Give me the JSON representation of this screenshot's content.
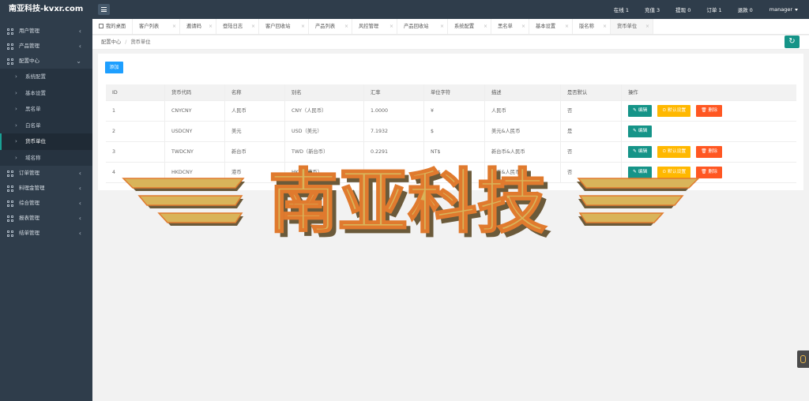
{
  "header": {
    "logo": "南亚科技-kvxr.com",
    "stats": [
      "在线 1",
      "充值 3",
      "提现 0",
      "订单 1",
      "退款 0"
    ],
    "user": "manager"
  },
  "sidebar": {
    "top_items": [
      {
        "label": "用户管理",
        "chevron": "‹"
      },
      {
        "label": "产品管理",
        "chevron": "‹"
      },
      {
        "label": "配置中心",
        "chevron": "⌄"
      }
    ],
    "sub_items": [
      {
        "label": "系统配置"
      },
      {
        "label": "基本设置"
      },
      {
        "label": "黑名单"
      },
      {
        "label": "白名单"
      },
      {
        "label": "货币单位"
      },
      {
        "label": "域名称"
      }
    ],
    "bottom_items": [
      {
        "label": "订单管理",
        "chevron": "‹"
      },
      {
        "label": "料理金管理",
        "chevron": "‹"
      },
      {
        "label": "综合管理",
        "chevron": "‹"
      },
      {
        "label": "报表管理",
        "chevron": "‹"
      },
      {
        "label": "结单管理",
        "chevron": "‹"
      }
    ]
  },
  "tabs": [
    {
      "label": "我的桌面",
      "close": ""
    },
    {
      "label": "客户列表",
      "close": "×"
    },
    {
      "label": "邀请码",
      "close": "×"
    },
    {
      "label": "登陆日志",
      "close": "×"
    },
    {
      "label": "客户回收站",
      "close": "×"
    },
    {
      "label": "产品列表",
      "close": "×"
    },
    {
      "label": "风控管理",
      "close": "×"
    },
    {
      "label": "产品回收站",
      "close": "×"
    },
    {
      "label": "系统配置",
      "close": "×"
    },
    {
      "label": "黑名单",
      "close": "×"
    },
    {
      "label": "基本设置",
      "close": "×"
    },
    {
      "label": "版名称",
      "close": "×"
    },
    {
      "label": "货币单位",
      "close": "×"
    }
  ],
  "breadcrumb": {
    "parent": "配置中心",
    "separator": "/",
    "current": "货币单位"
  },
  "refresh_icon": "↻",
  "add_button": "添加",
  "table": {
    "headers": [
      "ID",
      "货币代码",
      "名称",
      "别名",
      "汇率",
      "单位字符",
      "描述",
      "是否默认",
      "操作"
    ],
    "rows": [
      {
        "cells": [
          "1",
          "CNYCNY",
          "人民币",
          "CNY（人民币）",
          "1.0000",
          "¥",
          "人民币",
          "否"
        ],
        "buttons": [
          "编辑",
          "默认设置",
          "删除"
        ]
      },
      {
        "cells": [
          "2",
          "USDCNY",
          "美元",
          "USD（美元）",
          "7.1932",
          "$",
          "美元&人民币",
          "是"
        ],
        "buttons": [
          "编辑"
        ]
      },
      {
        "cells": [
          "3",
          "TWDCNY",
          "新台币",
          "TWD（新台币）",
          "0.2291",
          "NT$",
          "新台币&人民币",
          "否"
        ],
        "buttons": [
          "编辑",
          "默认设置",
          "删除"
        ]
      },
      {
        "cells": [
          "4",
          "HKDCNY",
          "港币",
          "HKD（港币）",
          "0.9166",
          "HK$",
          "港币&人民币",
          "否"
        ],
        "buttons": [
          "编辑",
          "默认设置",
          "删除"
        ]
      }
    ]
  },
  "button_icons": {
    "edit": "✎",
    "default": "⊙",
    "delete": "🗑"
  },
  "watermark": {
    "text": "南亚科技",
    "colors": {
      "fill": "#d9b45a",
      "shadow": "#6b5a3a",
      "edge": "#e07a2e"
    }
  },
  "colors": {
    "sidebar": "#2f3d4b",
    "accent": "#159488",
    "primary": "#1e9fff",
    "warn": "#ffb800",
    "danger": "#ff5722"
  }
}
